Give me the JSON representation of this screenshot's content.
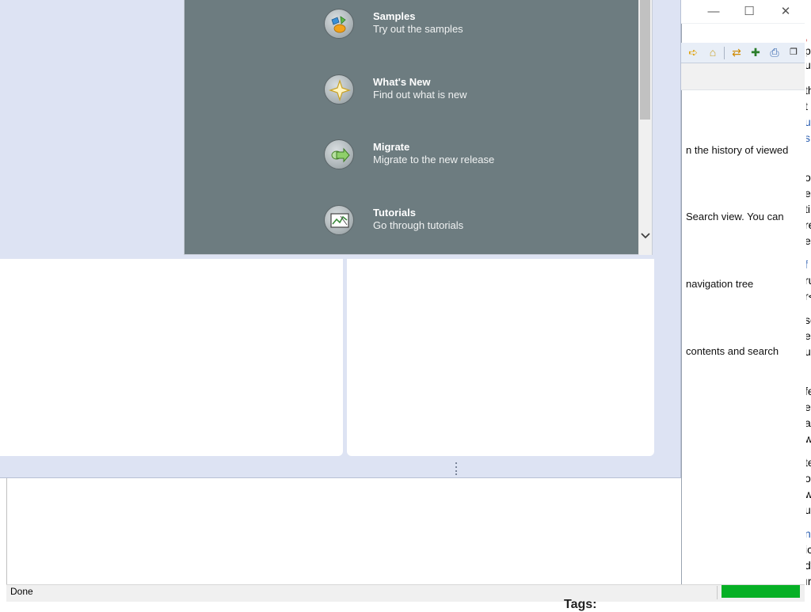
{
  "welcome": {
    "items": [
      {
        "title": "Samples",
        "desc": "Try out the samples",
        "icon": "samples-icon"
      },
      {
        "title": "What's New",
        "desc": "Find out what is new",
        "icon": "whats-new-icon"
      },
      {
        "title": "Migrate",
        "desc": "Migrate to the new release",
        "icon": "migrate-icon"
      },
      {
        "title": "Tutorials",
        "desc": "Go through tutorials",
        "icon": "tutorials-icon"
      }
    ]
  },
  "help": {
    "lines": [
      "n the history of viewed",
      "Search view. You can",
      "navigation tree",
      "contents and search"
    ],
    "window_buttons": {
      "minimize": "—",
      "maximize": "☐",
      "close": "✕"
    }
  },
  "status": {
    "text": "Done",
    "progress": 1.0
  },
  "background": {
    "tags_label": "Tags:"
  },
  "colors": {
    "welcome_bg": "#6d7c80",
    "frame_bg": "#dde3f3",
    "progress": "#06b025"
  }
}
